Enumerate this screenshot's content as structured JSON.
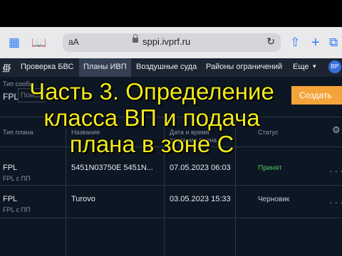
{
  "browser": {
    "text_size_label": "аА",
    "url": "sppi.ivprf.ru",
    "icons": [
      "sidebar-icon",
      "bookmarks-icon",
      "reload-icon",
      "share-icon",
      "new-tab-icon",
      "tabs-icon"
    ]
  },
  "nav": {
    "items": [
      {
        "label": "Проверка БВС"
      },
      {
        "label": "Планы ИВП"
      },
      {
        "label": "Воздушные суда"
      },
      {
        "label": "Районы ограничений"
      },
      {
        "label": "Еще"
      }
    ],
    "avatar": "ВР"
  },
  "toolbar": {
    "type_label": "Тип сообщ.",
    "type_value": "FPL",
    "search_placeholder": "Поиск",
    "create_label": "Создать"
  },
  "table": {
    "headers": {
      "col1": "Тип плана",
      "name": "Название",
      "date_line1": "Дата и время",
      "date_line2": "создания плана",
      "status": "Статус"
    },
    "rows": [
      {
        "type": "FPL",
        "sub": "FPL с ПП",
        "name": "5451N03750E 5451N...",
        "date": "07.05.2023 06:03",
        "status": "Принят"
      },
      {
        "type": "FPL",
        "sub": "FPL с ПП",
        "name": "Turovo",
        "date": "03.05.2023 15:33",
        "status": "Черновик"
      }
    ]
  },
  "overlay_title": {
    "line1": "Часть 3. Определение",
    "line2": "класса ВП и подача",
    "line3": "плана в зоне С"
  }
}
